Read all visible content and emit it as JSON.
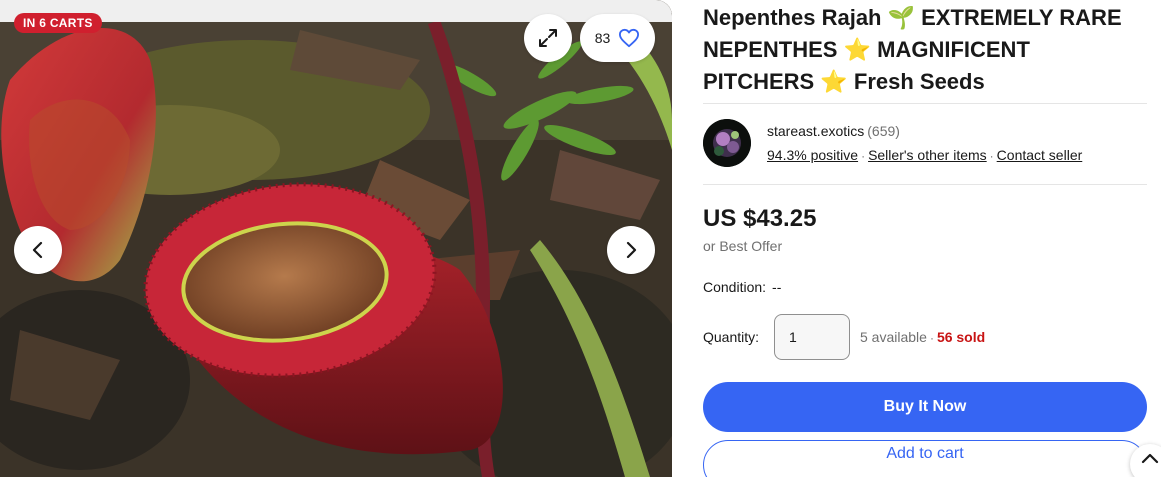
{
  "gallery": {
    "cart_badge": "IN 6 CARTS",
    "watch_count": "83",
    "icons": {
      "expand": "expand-icon",
      "favorite": "heart-icon",
      "prev": "chevron-left-icon",
      "next": "chevron-right-icon"
    }
  },
  "listing": {
    "title_part1": "Nepenthes Rajah ",
    "title_emoji1": "🌱",
    "title_part2": " EXTREMELY RARE NEPENTHES ",
    "title_emoji2": "⭐",
    "title_part3": " MAGNIFICENT PITCHERS ",
    "title_emoji3": "⭐",
    "title_part4": " Fresh Seeds"
  },
  "seller": {
    "name": "stareast.exotics",
    "feedback_count": "(659)",
    "positive": "94.3% positive",
    "other_items": "Seller's other items",
    "contact": "Contact seller"
  },
  "pricing": {
    "price": "US $43.25",
    "best_offer": "or Best Offer"
  },
  "condition": {
    "label": "Condition:",
    "value": "--"
  },
  "quantity": {
    "label": "Quantity:",
    "value": "1",
    "available": "5 available",
    "sold": "56 sold"
  },
  "actions": {
    "buy_now": "Buy It Now",
    "add_to_cart": "Add to cart"
  },
  "colors": {
    "accent": "#3665f3",
    "badge": "#d01f2e",
    "sold": "#c81414"
  }
}
